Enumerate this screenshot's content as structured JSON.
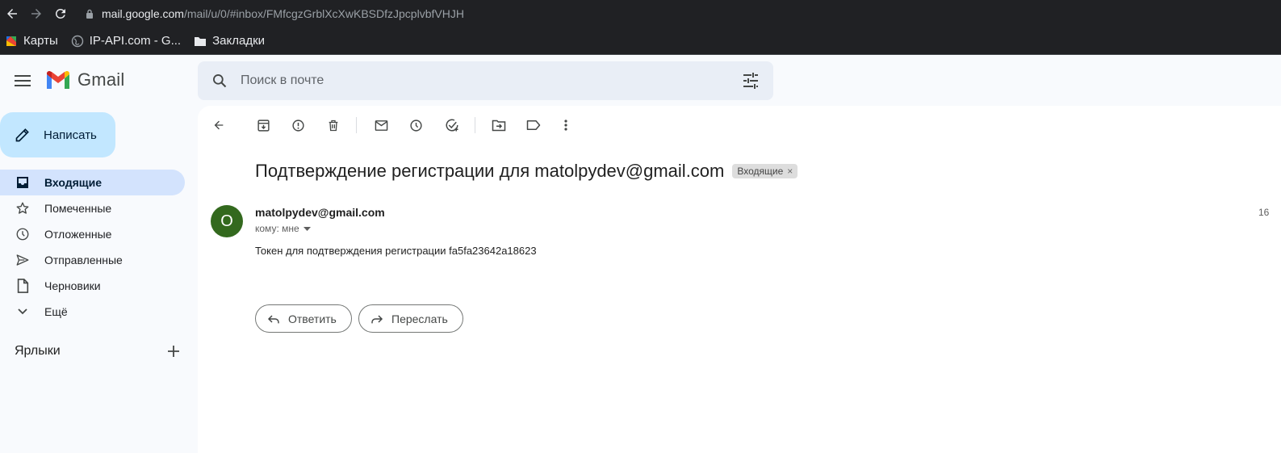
{
  "browser": {
    "url_host": "mail.google.com",
    "url_path": "/mail/u/0/#inbox/FMfcgzGrblXcXwKBSDfzJpcplvbfVHJH",
    "bookmarks": [
      {
        "label": "Карты",
        "icon": "maps-icon"
      },
      {
        "label": "IP-API.com - G...",
        "icon": "globe-icon"
      },
      {
        "label": "Закладки",
        "icon": "folder-icon"
      }
    ]
  },
  "header": {
    "app_name": "Gmail",
    "search_placeholder": "Поиск в почте"
  },
  "sidebar": {
    "compose_label": "Написать",
    "items": [
      {
        "label": "Входящие",
        "icon": "inbox-icon",
        "active": true
      },
      {
        "label": "Помеченные",
        "icon": "star-icon"
      },
      {
        "label": "Отложенные",
        "icon": "clock-icon"
      },
      {
        "label": "Отправленные",
        "icon": "send-icon"
      },
      {
        "label": "Черновики",
        "icon": "draft-icon"
      },
      {
        "label": "Ещё",
        "icon": "chevron-down-icon"
      }
    ],
    "labels_title": "Ярлыки"
  },
  "message": {
    "subject": "Подтверждение регистрации для matolpydev@gmail.com",
    "label_chip": "Входящие",
    "chip_close": "×",
    "avatar_letter": "O",
    "sender": "matolpydev@gmail.com",
    "to": "кому: мне",
    "time": "16",
    "body": "Токен для подтверждения регистрации fa5fa23642a18623",
    "reply_label": "Ответить",
    "forward_label": "Переслать"
  }
}
